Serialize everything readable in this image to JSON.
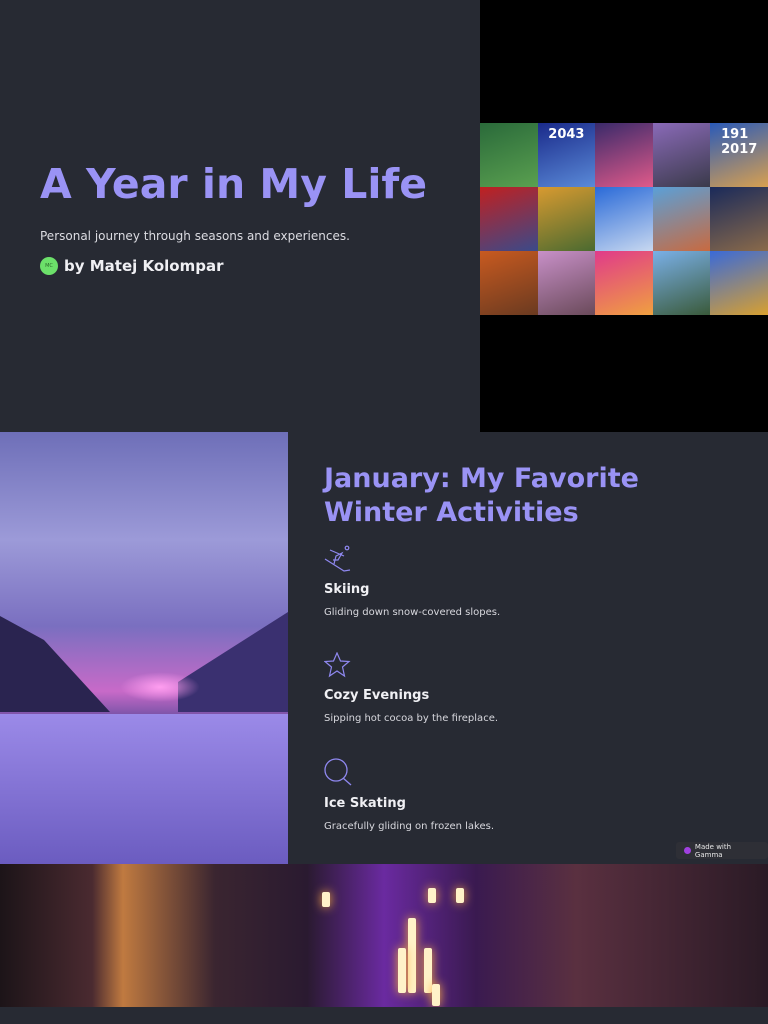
{
  "cover": {
    "title": "A Year in My Life",
    "subtitle": "Personal journey through seasons and experiences.",
    "author_initials": "MC",
    "author": "by Matej Kolompar",
    "collage_tiles": [
      {
        "colors": [
          "#2a6a3a",
          "#5aa050"
        ],
        "text": ""
      },
      {
        "colors": [
          "#1a2a8a",
          "#5a8ad8"
        ],
        "text": "2043"
      },
      {
        "colors": [
          "#3a2a6a",
          "#e05a8a"
        ],
        "text": ""
      },
      {
        "colors": [
          "#8a6ab8",
          "#3a3a4a"
        ],
        "text": ""
      },
      {
        "colors": [
          "#2a5ab8",
          "#d8a050"
        ],
        "text": "191 2017"
      },
      {
        "colors": [
          "#c02020",
          "#3a4a8a"
        ],
        "text": ""
      },
      {
        "colors": [
          "#d89a30",
          "#4a6a30"
        ],
        "text": ""
      },
      {
        "colors": [
          "#2a6ad8",
          "#c8d8f0"
        ],
        "text": ""
      },
      {
        "colors": [
          "#5aa0d8",
          "#c86a40"
        ],
        "text": ""
      },
      {
        "colors": [
          "#1a2a5a",
          "#8a6a4a"
        ],
        "text": ""
      },
      {
        "colors": [
          "#c85a20",
          "#6a3a20"
        ],
        "text": ""
      },
      {
        "colors": [
          "#c890c8",
          "#6a4a5a"
        ],
        "text": ""
      },
      {
        "colors": [
          "#e03a8a",
          "#f0a040"
        ],
        "text": ""
      },
      {
        "colors": [
          "#7ab0e8",
          "#3a5a3a"
        ],
        "text": ""
      },
      {
        "colors": [
          "#3a6ad8",
          "#d8a030"
        ],
        "text": ""
      }
    ]
  },
  "january": {
    "heading": "January: My Favorite Winter Activities",
    "items": [
      {
        "icon": "skiing-icon",
        "title": "Skiing",
        "desc": "Gliding down snow-covered slopes."
      },
      {
        "icon": "star-icon",
        "title": "Cozy Evenings",
        "desc": "Sipping hot cocoa by the fireplace."
      },
      {
        "icon": "search-icon",
        "title": "Ice Skating",
        "desc": "Gracefully gliding on frozen lakes."
      }
    ]
  },
  "badge": {
    "label": "Made with Gamma"
  },
  "colors": {
    "accent": "#9a93f5",
    "background": "#272a33"
  }
}
